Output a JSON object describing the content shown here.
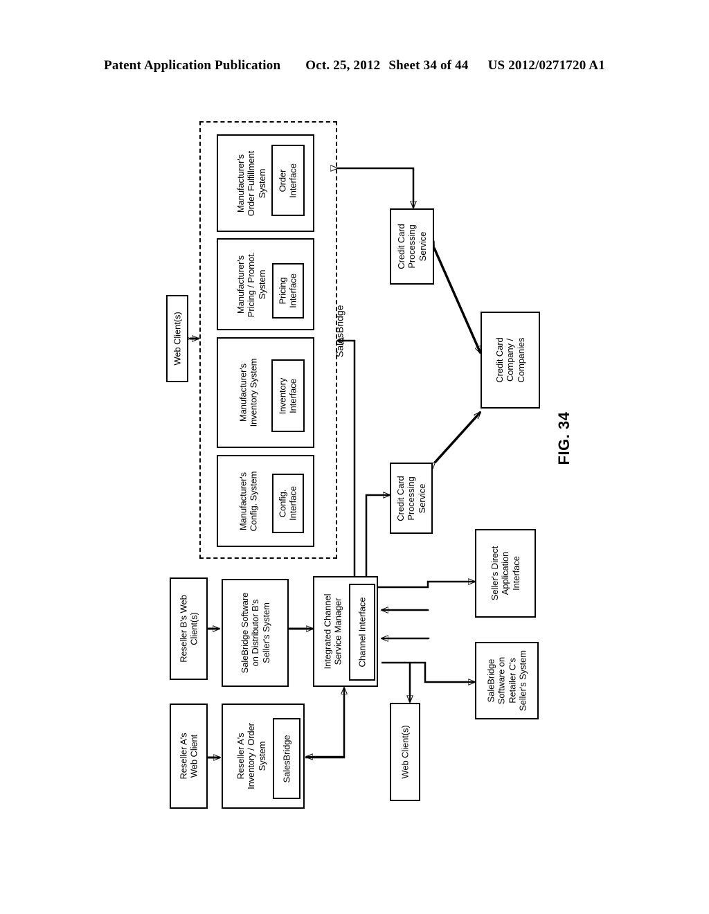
{
  "header": {
    "publication": "Patent Application Publication",
    "date": "Oct. 25, 2012",
    "sheet": "Sheet 34 of 44",
    "patent_number": "US 2012/0271720 A1"
  },
  "figure": {
    "label": "FIG. 34",
    "boundary_label": "SalesBridge"
  },
  "boxes": {
    "web_clients_left": "Web Client(s)",
    "order_fulfillment": "Manufacturer's\nOrder Fulfillment\nSystem",
    "order_interface": "Order\nInterface",
    "pricing_promo": "Manufacturer's\nPricing / Promot.\nSystem",
    "pricing_interface": "Pricing\nInterface",
    "inventory_system": "Manufacturer's\nInventory System",
    "inventory_interface": "Inventory\nInterface",
    "config_system": "Manufacturer's\nConfig. System",
    "config_interface": "Config.\nInterface",
    "ccps_top": "Credit Card\nProcessing\nService",
    "ccps_bottom": "Credit Card\nProcessing\nService",
    "credit_card_company": "Credit Card\nCompany /\nCompanies",
    "reseller_b_web_client": "Reseller B's Web\nClient(s)",
    "salebridge_distributor_b": "SaleBridge Software\non Distributor B's\nSeller's System",
    "integrated_channel_service_manager": "Integrated Channel\nService Manager",
    "channel_interface": "Channel Interface",
    "sellers_direct_app_interface": "Seller's Direct\nApplication\nInterface",
    "salebridge_retailer_c": "SaleBridge\nSoftware on\nRetailer C's\nSeller's System",
    "reseller_a_web_client": "Reseller A's\nWeb Client",
    "reseller_a_inventory_order": "Reseller A's\nInventory / Order\nSystem",
    "reseller_a_salesbridge": "SalesBridge",
    "web_clients_bottom": "Web Client(s)"
  }
}
